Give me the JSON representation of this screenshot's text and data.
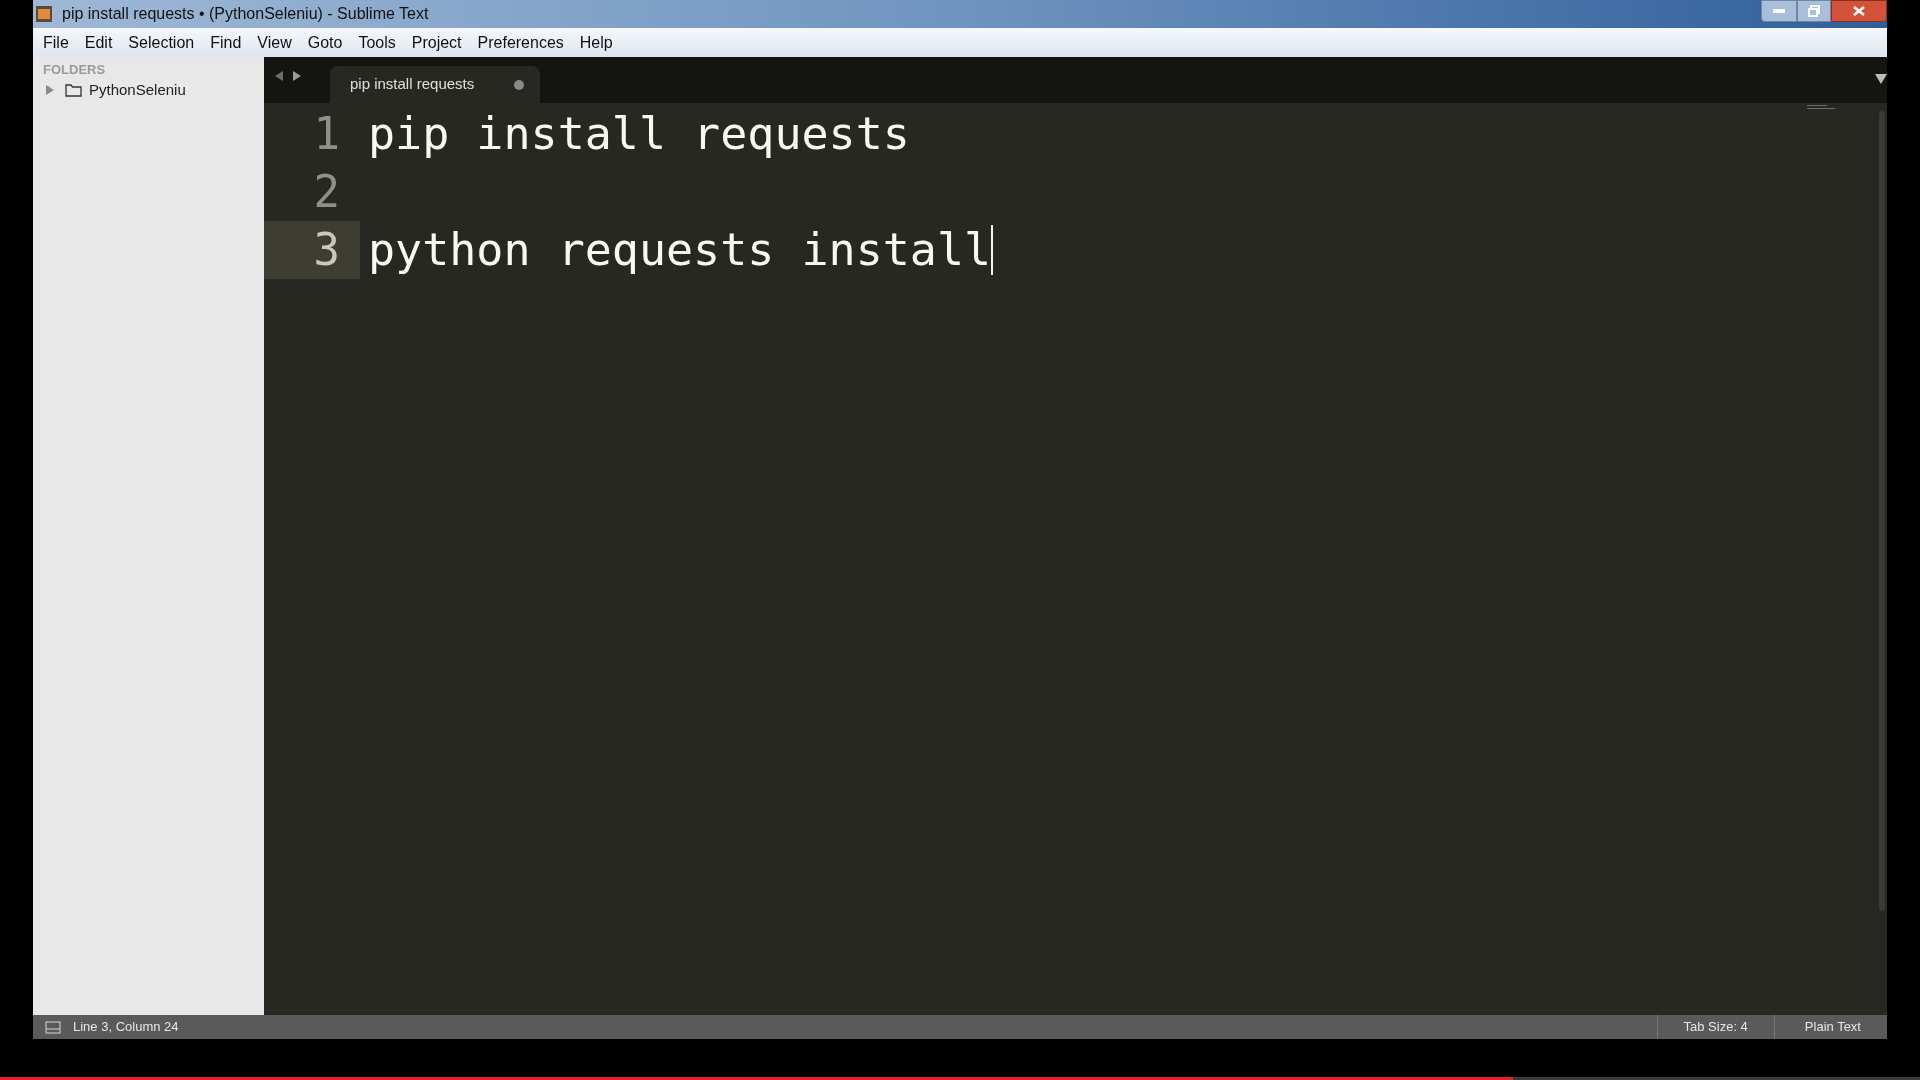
{
  "window": {
    "title": "pip install requests • (PythonSeleniu) - Sublime Text"
  },
  "menu": [
    "File",
    "Edit",
    "Selection",
    "Find",
    "View",
    "Goto",
    "Tools",
    "Project",
    "Preferences",
    "Help"
  ],
  "sidebar": {
    "heading": "FOLDERS",
    "items": [
      {
        "label": "PythonSeleniu",
        "expanded": false
      }
    ]
  },
  "tabs": [
    {
      "label": "pip install requests",
      "selected": true,
      "modified": true
    }
  ],
  "editor": {
    "lines": [
      {
        "number": "1",
        "text": "pip install requests",
        "current": false
      },
      {
        "number": "2",
        "current": false
      },
      {
        "number": "3",
        "text": "python requests install",
        "current": true
      }
    ]
  },
  "status_bar": {
    "position": "Line 3, Column 24",
    "tab_size": "Tab Size: 4",
    "syntax": "Plain Text"
  },
  "video_progress": {
    "level": 0.788
  }
}
